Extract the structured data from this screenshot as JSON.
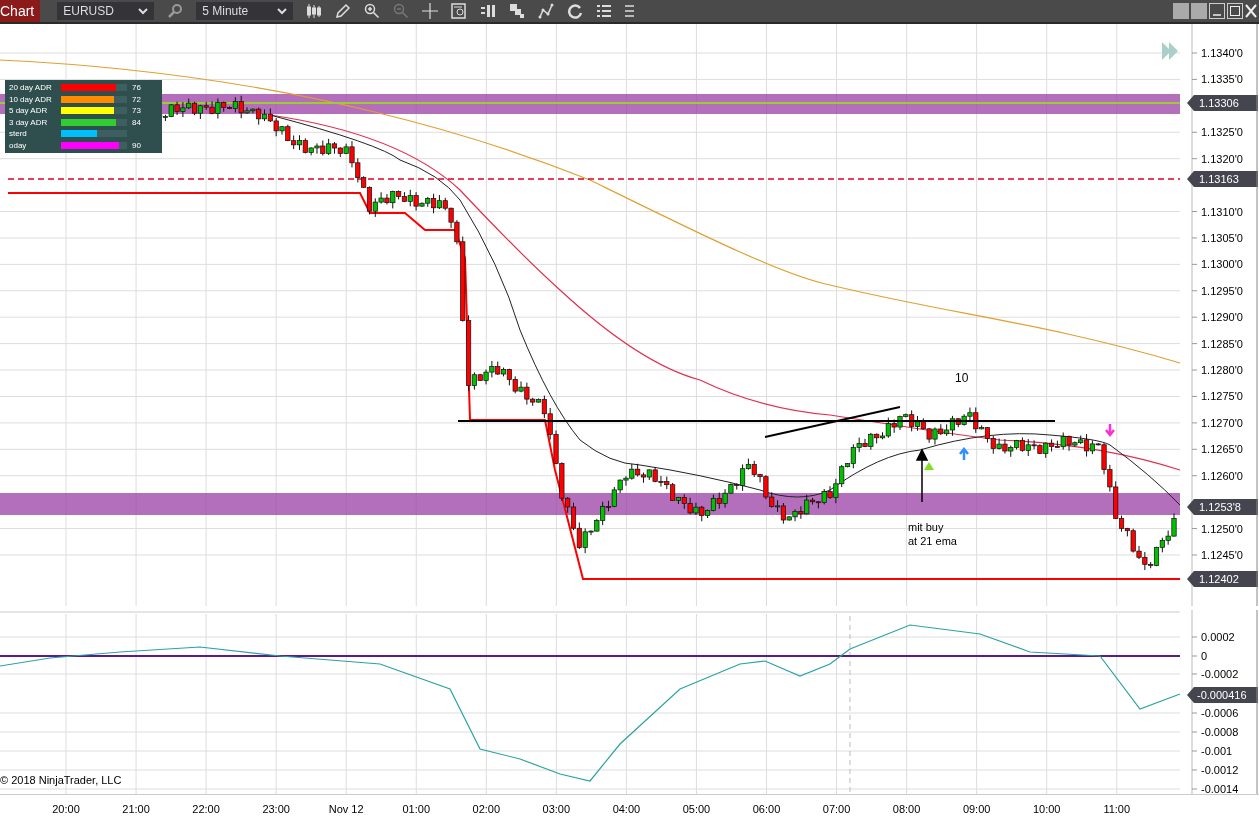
{
  "toolbar": {
    "chart_button": "Chart",
    "instrument": "EURUSD",
    "interval": "5 Minute"
  },
  "adr_legend": [
    {
      "label": "20 day ADR",
      "color": "#ff0000",
      "level": 0.83,
      "value": "76"
    },
    {
      "label": "10 day ADR",
      "color": "#ff8c00",
      "level": 0.8,
      "value": "72"
    },
    {
      "label": "5 day ADR",
      "color": "#ffff00",
      "level": 0.8,
      "value": "73"
    },
    {
      "label": "3 day ADR",
      "color": "#32cd32",
      "level": 0.83,
      "value": "84"
    },
    {
      "label": "sterd",
      "color": "#00bfff",
      "level": 0.55
    },
    {
      "label": "oday",
      "color": "#ff00ff",
      "level": 0.88,
      "value": "90"
    }
  ],
  "price_axis": {
    "ticks": [
      "1.1340'0",
      "1.1335'0",
      "1.1325'0",
      "1.1320'0",
      "1.1310'0",
      "1.1305'0",
      "1.1300'0",
      "1.1295'0",
      "1.1290'0",
      "1.1285'0",
      "1.1280'0",
      "1.1275'0",
      "1.1270'0",
      "1.1265'0",
      "1.1260'0",
      "1.1250'0",
      "1.1245'0"
    ],
    "tags": [
      "1.13306",
      "1.13163",
      "1.1253'8",
      "1.12402"
    ]
  },
  "annotations": [
    {
      "kind": "count",
      "text": "10"
    },
    {
      "kind": "note",
      "text": "mit buy"
    },
    {
      "kind": "note",
      "text": "at 21 ema"
    }
  ],
  "indicator_axis": {
    "ticks": [
      "0.0002",
      "0",
      "-0.0002",
      "-0.0006",
      "-0.0008",
      "-0.001",
      "-0.0012",
      "-0.0014"
    ],
    "tag": "-0.000416"
  },
  "time_axis": [
    "20:00",
    "21:00",
    "22:00",
    "23:00",
    "Nov 12",
    "01:00",
    "02:00",
    "03:00",
    "04:00",
    "05:00",
    "06:00",
    "07:00",
    "08:00",
    "09:00",
    "10:00",
    "11:00"
  ],
  "copyright": "© 2018 NinjaTrader, LLC"
}
